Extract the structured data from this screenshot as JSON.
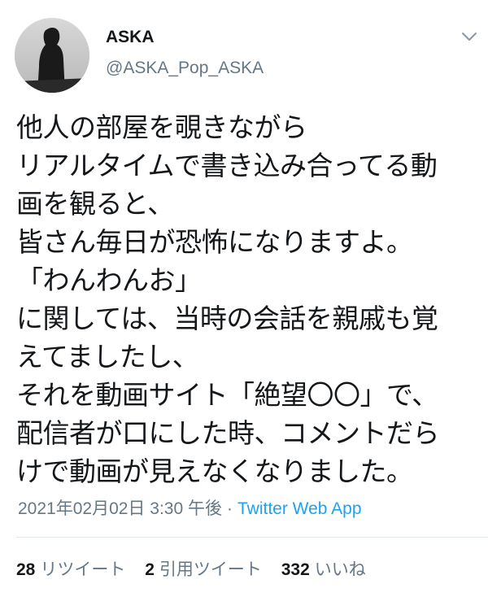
{
  "user": {
    "display_name": "ASKA",
    "handle": "@ASKA_Pop_ASKA",
    "avatar_icon": "profile-photo-silhouette"
  },
  "tweet": {
    "lines": [
      "他人の部屋を覗きながら",
      "リアルタイムで書き込み合ってる動",
      "画を観ると、",
      "皆さん毎日が恐怖になりますよ。",
      "「わんわんお」",
      "に関しては、当時の会話を親戚も覚",
      "えてましたし、",
      "それを動画サイト「絶望〇〇」で、",
      "配信者が口にした時、コメントだら",
      "けで動画が見えなくなりました。"
    ]
  },
  "meta": {
    "timestamp": "2021年02月02日 3:30 午後",
    "separator": "·",
    "source": "Twitter Web App"
  },
  "stats": {
    "retweets_count": "28",
    "retweets_label": "リツイート",
    "quotes_count": "2",
    "quotes_label": "引用ツイート",
    "likes_count": "332",
    "likes_label": "いいね"
  },
  "colors": {
    "text": "#14171a",
    "secondary": "#657786",
    "link": "#1da1f2",
    "divider": "#e1e8ed"
  }
}
